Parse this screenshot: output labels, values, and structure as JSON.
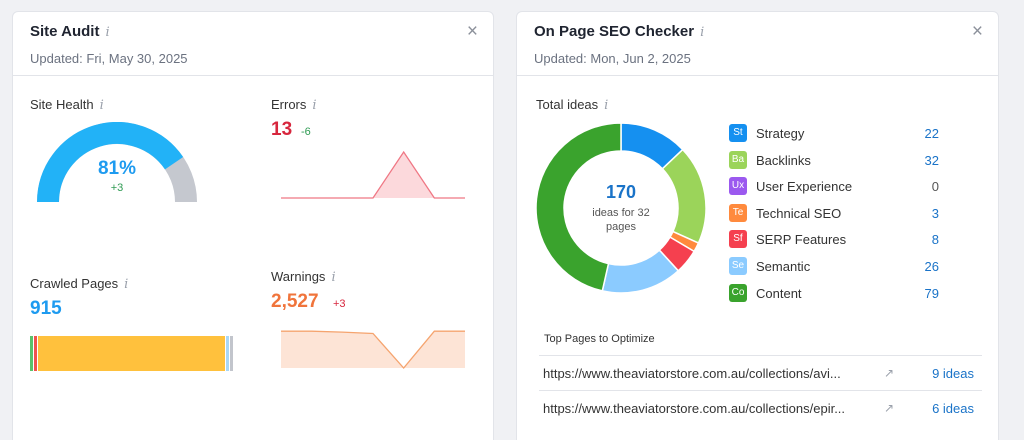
{
  "site_audit": {
    "title": "Site Audit",
    "updated": "Updated: Fri, May 30, 2025",
    "site_health": {
      "label": "Site Health",
      "value": "81%",
      "delta": "+3",
      "fraction": 0.81
    },
    "errors": {
      "label": "Errors",
      "value": "13",
      "delta": "-6",
      "trend": [
        0,
        0,
        0,
        0,
        1,
        0,
        0
      ]
    },
    "crawled_pages": {
      "label": "Crawled Pages",
      "value": "915",
      "segments": [
        {
          "share": 0.02,
          "color": "#59c26b"
        },
        {
          "share": 0.02,
          "color": "#f0534f"
        },
        {
          "share": 0.92,
          "color": "#ffc13d"
        },
        {
          "share": 0.02,
          "color": "#a9d7f5"
        },
        {
          "share": 0.02,
          "color": "#c2c5cc"
        }
      ]
    },
    "warnings": {
      "label": "Warnings",
      "value": "2,527",
      "delta": "+3",
      "trend": [
        0.8,
        0.8,
        0.78,
        0.75,
        0,
        0.8,
        0.8
      ]
    }
  },
  "seo_checker": {
    "title": "On Page SEO Checker",
    "updated": "Updated: Mon, Jun 2, 2025",
    "total_ideas_label": "Total ideas",
    "center_value": "170",
    "center_caption": "ideas for 32 pages",
    "categories": [
      {
        "abbr": "St",
        "name": "Strategy",
        "count": "22",
        "value": 22,
        "color": "#1590f0"
      },
      {
        "abbr": "Ba",
        "name": "Backlinks",
        "count": "32",
        "value": 32,
        "color": "#9bd45a"
      },
      {
        "abbr": "Ux",
        "name": "User Experience",
        "count": "0",
        "value": 0,
        "color": "#9b59ef"
      },
      {
        "abbr": "Te",
        "name": "Technical SEO",
        "count": "3",
        "value": 3,
        "color": "#ff8a3d"
      },
      {
        "abbr": "Sf",
        "name": "SERP Features",
        "count": "8",
        "value": 8,
        "color": "#f5404f"
      },
      {
        "abbr": "Se",
        "name": "Semantic",
        "count": "26",
        "value": 26,
        "color": "#8bcbff"
      },
      {
        "abbr": "Co",
        "name": "Content",
        "count": "79",
        "value": 79,
        "color": "#3aa32d"
      }
    ],
    "top_pages_title": "Top Pages to Optimize",
    "top_pages": [
      {
        "url": "https://www.theaviatorstore.com.au/collections/avi...",
        "ideas": "9 ideas"
      },
      {
        "url": "https://www.theaviatorstore.com.au/collections/epir...",
        "ideas": "6 ideas"
      }
    ]
  }
}
